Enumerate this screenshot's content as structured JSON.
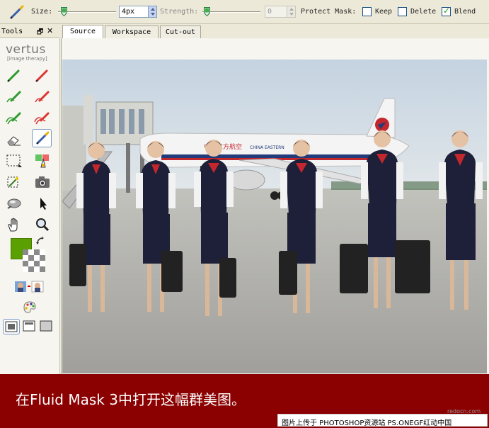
{
  "toolbar": {
    "size_label": "Size:",
    "size_value": "4px",
    "strength_label": "Strength:",
    "strength_value": "0",
    "protect_mask_label": "Protect Mask:",
    "keep_label": "Keep",
    "delete_label": "Delete",
    "blend_label": "Blend",
    "keep_checked": false,
    "delete_checked": false,
    "blend_checked": true
  },
  "tools_panel": {
    "title": "Tools",
    "pin_glyph": "🗗",
    "close_glyph": "✕",
    "logo": "vertus",
    "logo_tagline": "[image therapy]",
    "foreground_color": "#5aa000"
  },
  "tabs": [
    {
      "label": "Source",
      "active": true
    },
    {
      "label": "Workspace",
      "active": false
    },
    {
      "label": "Cut-out",
      "active": false
    }
  ],
  "caption": {
    "text": "在Fluid Mask 3中打开这幅群美图。",
    "watermark": "redocn.com",
    "credit": "图片上传于 PHOTOSHOP资源站  PS.ONEGF红动中国"
  },
  "photo": {
    "plane_livery": "中国东方航空",
    "plane_name": "CHINA EASTERN"
  },
  "colors": {
    "caption_bg": "#8b0000",
    "toolbar_bg": "#ece9d8",
    "panel_bg": "#f6f5ef"
  }
}
